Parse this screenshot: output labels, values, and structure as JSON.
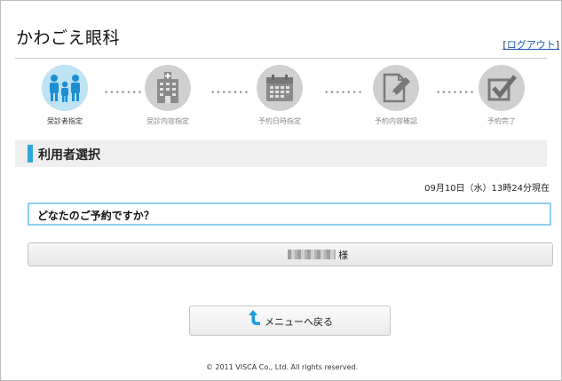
{
  "app": {
    "title": "かわごえ眼科",
    "logout": "ログアウト"
  },
  "steps": [
    {
      "label": "受診者指定",
      "icon": "family-icon",
      "active": true
    },
    {
      "label": "受診内容指定",
      "icon": "hospital-icon",
      "active": false
    },
    {
      "label": "予約日時指定",
      "icon": "calendar-icon",
      "active": false
    },
    {
      "label": "予約内容確認",
      "icon": "edit-document-icon",
      "active": false
    },
    {
      "label": "予約完了",
      "icon": "checkbox-icon",
      "active": false
    }
  ],
  "step_dots": "•••••••",
  "section": {
    "title": "利用者選択"
  },
  "datetime": "09月10日（水）13時24分現在",
  "question": "どなたのご予約ですか？",
  "user": {
    "suffix": "様"
  },
  "menu_button": {
    "label": "メニューへ戻る"
  },
  "footer": "© 2011 VISCA Co., Ltd. All rights reserved.",
  "colors": {
    "accent": "#2ea7dd",
    "active_step": "#bde3f5",
    "inactive_step": "#cfcfcf",
    "link": "#1a57b5"
  }
}
